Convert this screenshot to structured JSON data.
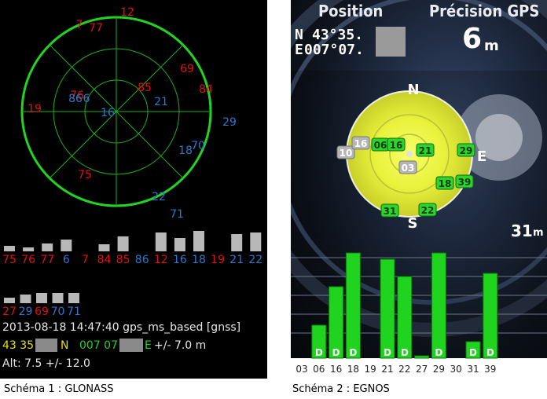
{
  "glonass": {
    "caption": "Schéma 1 : GLONASS",
    "colors": {
      "red": "#e01010",
      "blue": "#2b78cc",
      "ring": "#22d422",
      "grid": "#1fae1f",
      "bar": "#b8b8b8"
    },
    "skyplot_labels": [
      {
        "text": "12",
        "color": "red"
      },
      {
        "text": "7",
        "color": "red"
      },
      {
        "text": "77",
        "color": "red"
      },
      {
        "text": "85",
        "color": "red"
      },
      {
        "text": "69",
        "color": "red"
      },
      {
        "text": "84",
        "color": "red"
      },
      {
        "text": "76",
        "color": "red"
      },
      {
        "text": "86",
        "color": "blue"
      },
      {
        "text": "6",
        "color": "blue"
      },
      {
        "text": "21",
        "color": "blue"
      },
      {
        "text": "19",
        "color": "red"
      },
      {
        "text": "16",
        "color": "blue"
      },
      {
        "text": "29",
        "color": "blue"
      },
      {
        "text": "18",
        "color": "blue"
      },
      {
        "text": "70",
        "color": "blue"
      },
      {
        "text": "75",
        "color": "red"
      },
      {
        "text": "22",
        "color": "blue"
      },
      {
        "text": "71",
        "color": "blue"
      }
    ],
    "signal_bars_row1": [
      {
        "label": "75",
        "color": "red",
        "level": 0.2
      },
      {
        "label": "76",
        "color": "red",
        "level": 0.15
      },
      {
        "label": "77",
        "color": "red",
        "level": 0.3
      },
      {
        "label": "6",
        "color": "blue",
        "level": 0.45
      },
      {
        "label": "7",
        "color": "red",
        "level": 0
      },
      {
        "label": "84",
        "color": "red",
        "level": 0.25
      },
      {
        "label": "85",
        "color": "red",
        "level": 0.55
      },
      {
        "label": "86",
        "color": "blue",
        "level": 0
      },
      {
        "label": "12",
        "color": "red",
        "level": 0.7
      },
      {
        "label": "16",
        "color": "blue",
        "level": 0.5
      },
      {
        "label": "18",
        "color": "blue",
        "level": 0.75
      },
      {
        "label": "19",
        "color": "red",
        "level": 0
      },
      {
        "label": "21",
        "color": "blue",
        "level": 0.65
      },
      {
        "label": "22",
        "color": "blue",
        "level": 0.7
      }
    ],
    "signal_bars_row2": [
      {
        "label": "27",
        "color": "red",
        "level": 0.3
      },
      {
        "label": "29",
        "color": "blue",
        "level": 0.45
      },
      {
        "label": "69",
        "color": "red",
        "level": 0.55
      },
      {
        "label": "70",
        "color": "blue",
        "level": 0.55
      },
      {
        "label": "71",
        "color": "blue",
        "level": 0.55
      }
    ],
    "datetime_line": "2013-08-18 14:47:40  gps_ms_based [gnss]",
    "lat_value": "43 35",
    "lat_dir": "N",
    "lon_value": "007 07",
    "lon_dir": "E",
    "accuracy": "+/-   7.0 m",
    "alt_line": "Alt:   7.5  +/-   12.0"
  },
  "egnos": {
    "caption": "Schéma 2 : EGNOS",
    "position_title": "Position",
    "precision_title": "Précision GPS",
    "lat_label": "N",
    "lat_value": "43°35.",
    "lon_label": "E",
    "lon_value": "007°07.",
    "precision_value": "6",
    "precision_unit": "m",
    "altitude_value": "31",
    "altitude_unit": "m",
    "compass": {
      "north": "N",
      "east": "E",
      "south": "S"
    },
    "colors": {
      "bar": "#1fd31f",
      "bar_edge": "#0a7a0a",
      "sky_yellow": "#f4ff5a",
      "sat_green": "#2ed42e",
      "sat_grey": "#b5b5b5"
    },
    "sky_sats": [
      {
        "label": "10",
        "state": "grey"
      },
      {
        "label": "16",
        "state": "grey"
      },
      {
        "label": "06",
        "state": "green"
      },
      {
        "label": "16",
        "state": "green"
      },
      {
        "label": "21",
        "state": "green"
      },
      {
        "label": "29",
        "state": "green"
      },
      {
        "label": "03",
        "state": "grey"
      },
      {
        "label": "18",
        "state": "green"
      },
      {
        "label": "39",
        "state": "green"
      },
      {
        "label": "31",
        "state": "green"
      },
      {
        "label": "22",
        "state": "green"
      }
    ],
    "signal_bars": [
      {
        "label": "03",
        "level": 0,
        "flag": ""
      },
      {
        "label": "06",
        "level": 0.3,
        "flag": "D"
      },
      {
        "label": "16",
        "level": 0.65,
        "flag": "D"
      },
      {
        "label": "18",
        "level": 0.96,
        "flag": "D"
      },
      {
        "label": "19",
        "level": 0,
        "flag": ""
      },
      {
        "label": "21",
        "level": 0.9,
        "flag": "D"
      },
      {
        "label": "22",
        "level": 0.74,
        "flag": "D"
      },
      {
        "label": "27",
        "level": 0.02,
        "flag": ""
      },
      {
        "label": "29",
        "level": 0.96,
        "flag": "D"
      },
      {
        "label": "30",
        "level": 0,
        "flag": ""
      },
      {
        "label": "31",
        "level": 0.15,
        "flag": "D"
      },
      {
        "label": "39",
        "level": 0.77,
        "flag": "D"
      }
    ]
  }
}
